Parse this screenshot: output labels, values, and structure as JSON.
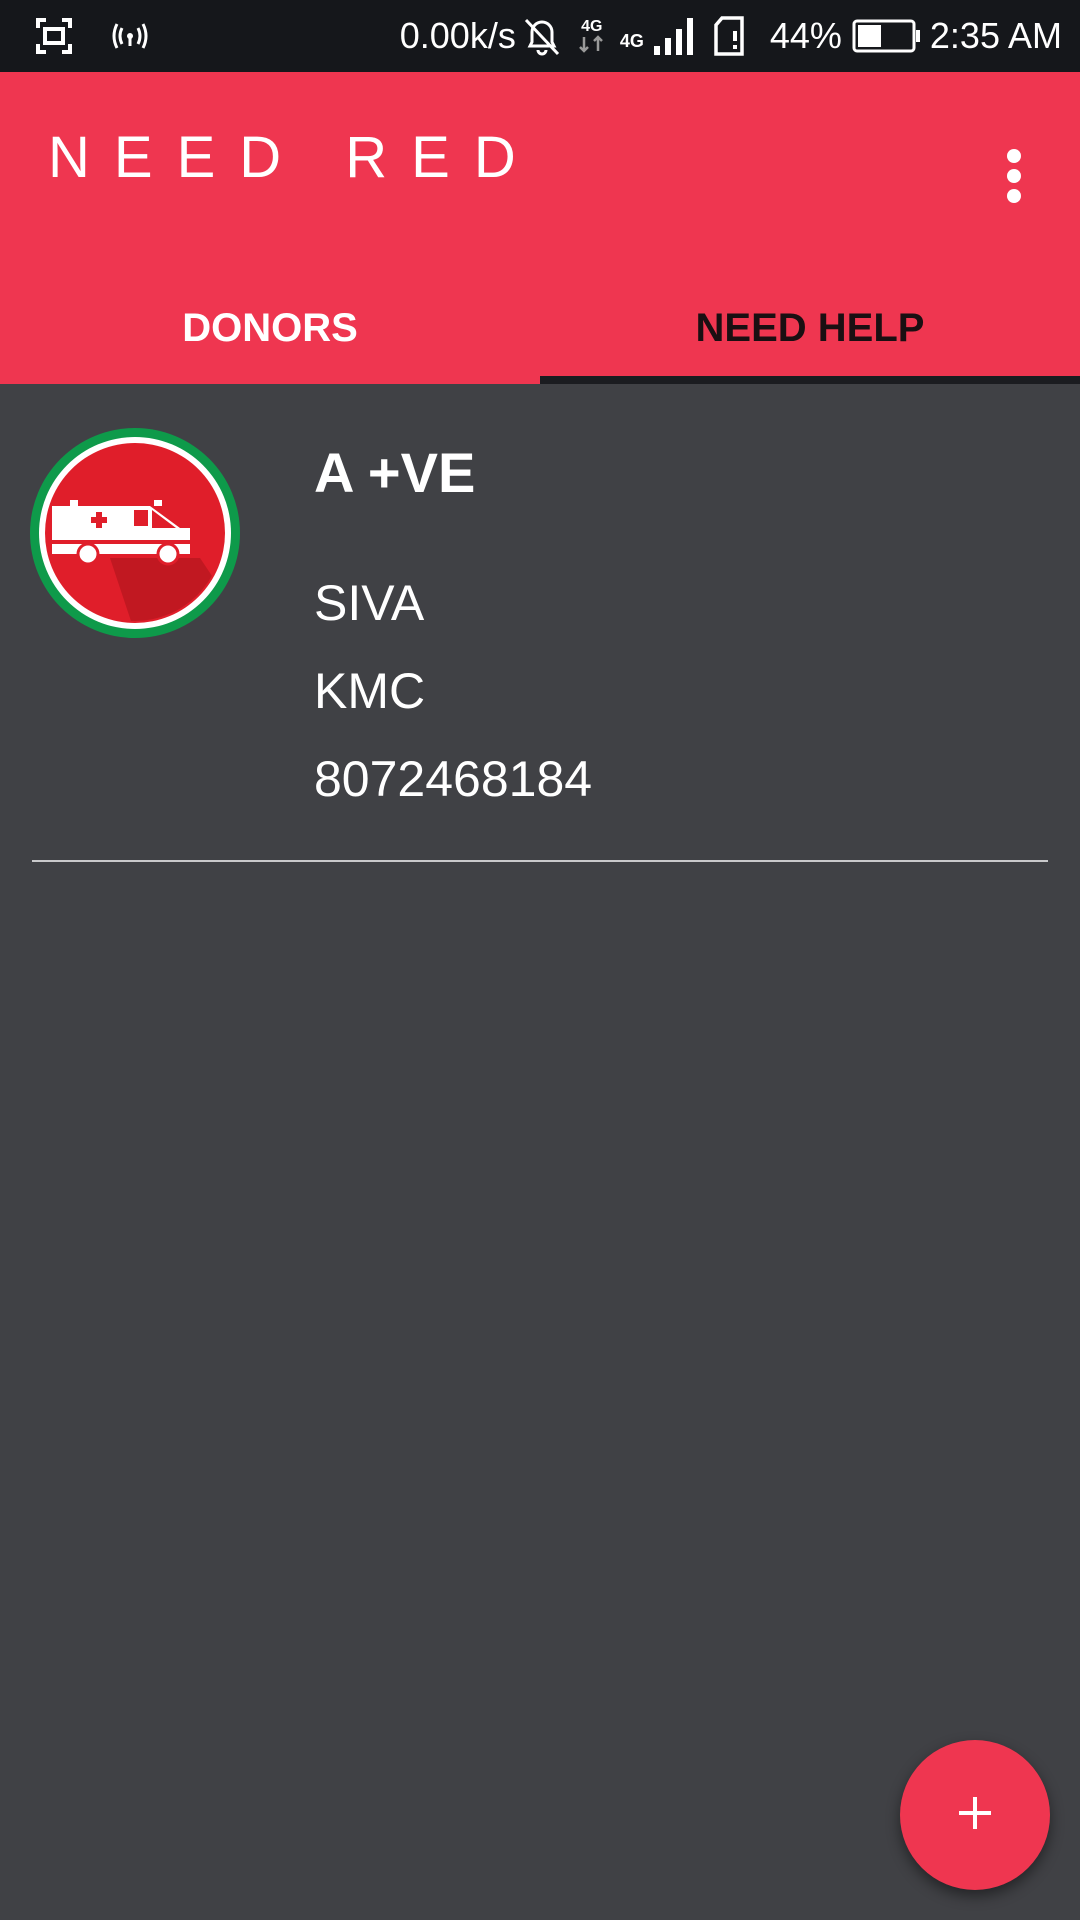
{
  "status_bar": {
    "net_speed": "0.00k/s",
    "battery_percent": "44%",
    "battery_level": 0.44,
    "time": "2:35 AM",
    "net_label_1": "4G",
    "net_label_2": "4G"
  },
  "app_bar": {
    "title": "NEED RED"
  },
  "tabs": [
    {
      "label": "DONORS",
      "selected": false
    },
    {
      "label": "NEED HELP",
      "selected": true
    }
  ],
  "entry": {
    "blood_group": "A +VE",
    "name": "SIVA",
    "place": "KMC",
    "phone": "8072468184"
  },
  "colors": {
    "accent": "#ef3650",
    "background": "#404145",
    "status_bar": "#15171b"
  },
  "icons": {
    "screenshot": "screenshot-icon",
    "hotspot": "hotspot-icon",
    "mute": "bell-off-icon",
    "signal": "signal-icon",
    "sim": "sim-card-icon",
    "battery": "battery-icon",
    "more": "more-vert-icon",
    "avatar": "ambulance-icon",
    "fab": "plus-icon"
  }
}
